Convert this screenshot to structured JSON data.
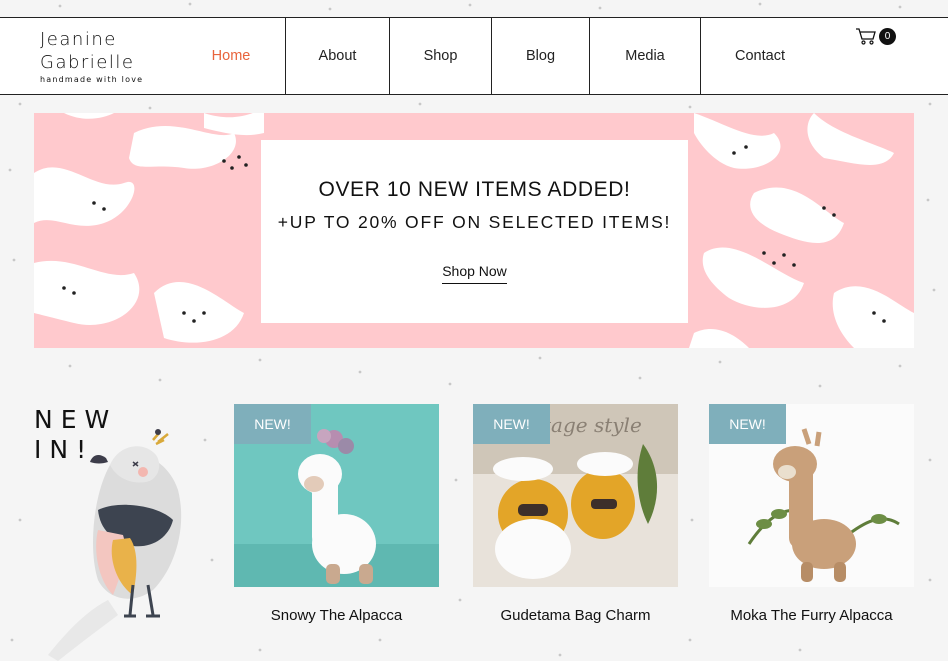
{
  "brand": {
    "name_line1": "Jeanine",
    "name_line2": "Gabrielle",
    "tagline": "handmade with love"
  },
  "nav": {
    "items": [
      {
        "label": "Home",
        "active": true
      },
      {
        "label": "About"
      },
      {
        "label": "Shop"
      },
      {
        "label": "Blog"
      },
      {
        "label": "Media"
      },
      {
        "label": "Contact"
      }
    ]
  },
  "cart": {
    "icon": "cart-icon",
    "count": "0"
  },
  "banner": {
    "title": "OVER 10 NEW ITEMS ADDED!",
    "subtitle": "+UP TO 20% OFF ON SELECTED ITEMS!",
    "cta": "Shop Now"
  },
  "new_in": {
    "line1": "NEW",
    "line2": "IN!"
  },
  "products": [
    {
      "badge": "NEW!",
      "name": "Snowy The Alpacca"
    },
    {
      "badge": "NEW!",
      "name": "Gudetama Bag Charm"
    },
    {
      "badge": "NEW!",
      "name": "Moka The Furry Alpacca"
    }
  ],
  "colors": {
    "accent": "#e8643c",
    "badge": "#7fafbb",
    "banner_pink": "#ffc9cd"
  }
}
